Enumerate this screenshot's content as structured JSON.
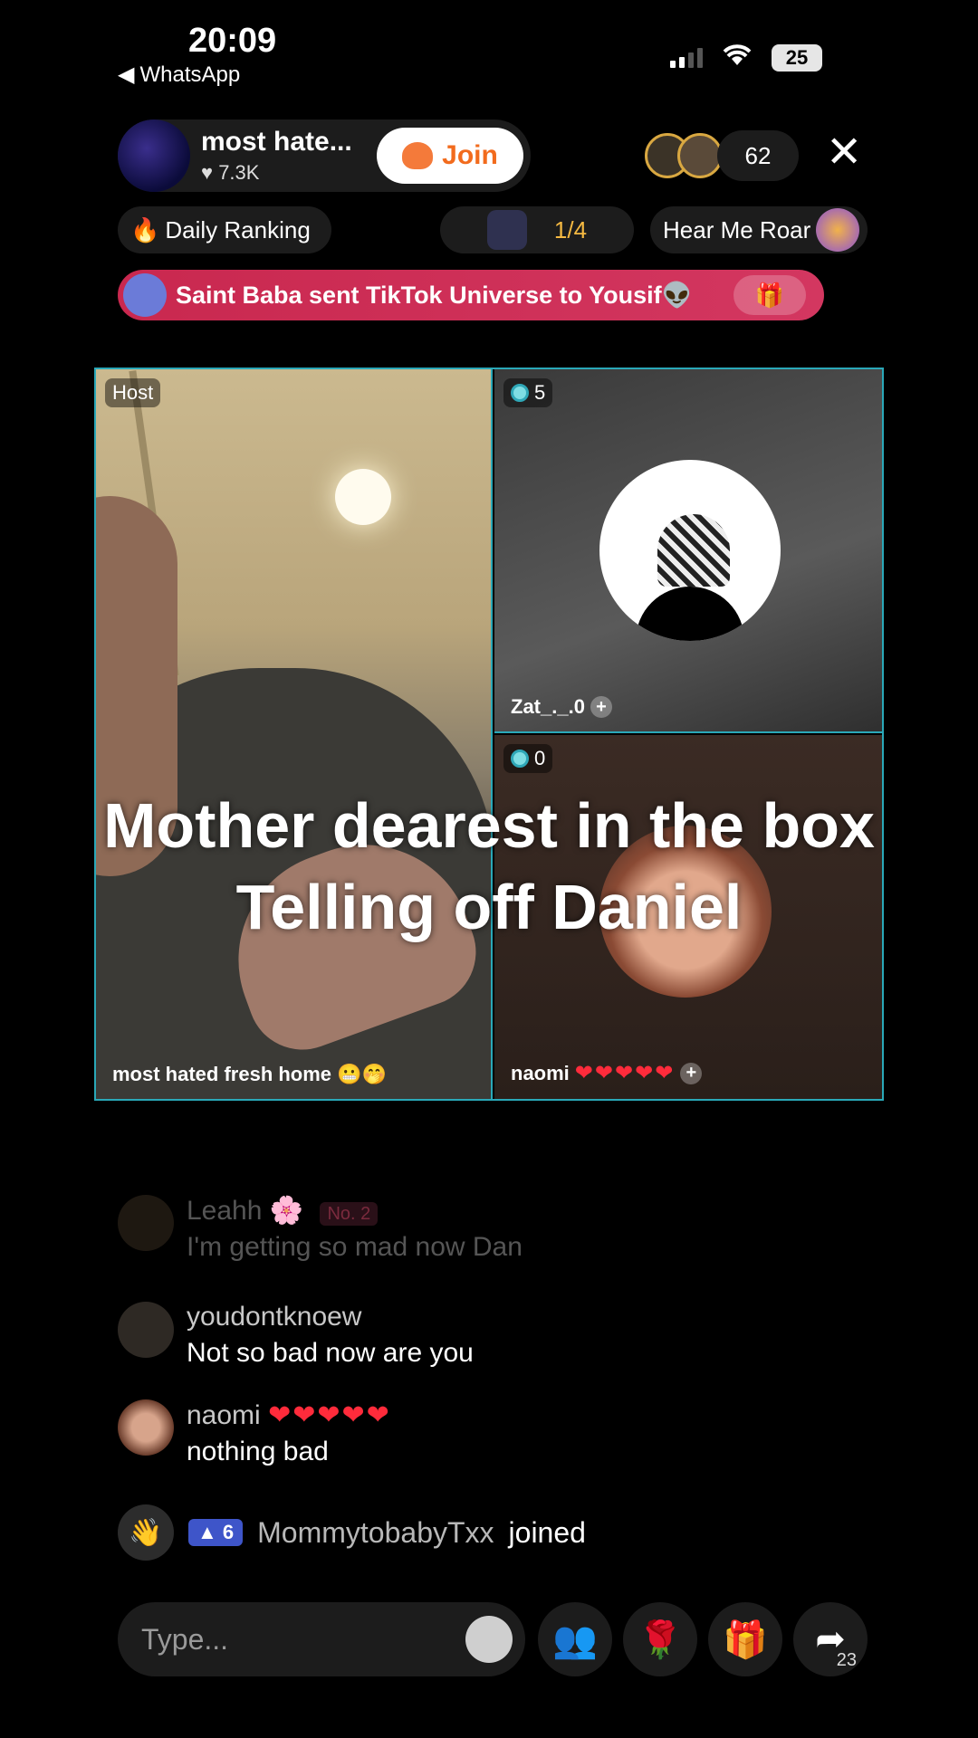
{
  "status_bar": {
    "time": "20:09",
    "back_app": "WhatsApp",
    "battery": "25"
  },
  "header": {
    "host_name": "most hate...",
    "host_likes": "7.3K",
    "join_label": "Join",
    "viewer_count": "62",
    "close_icon": "close-icon"
  },
  "chips": {
    "daily_ranking": "Daily Ranking",
    "rank_progress": "1/4",
    "hear_me": "Hear Me Roar"
  },
  "gift_banner": {
    "text": "Saint Baba sent TikTok Universe to Yousif"
  },
  "tiles": {
    "host_badge": "Host",
    "host_caption": "most hated fresh home",
    "zat_gems": "5",
    "zat_name": "Zat_._.0",
    "naomi_gems": "0",
    "naomi_name": "naomi"
  },
  "caption": {
    "line1": "Mother dearest in the box",
    "line2": "Telling off Daniel"
  },
  "chat": [
    {
      "user": "Leahh",
      "tag": "No. 2",
      "message": "I'm getting so mad now Dan"
    },
    {
      "user": "youdontknoew",
      "message": "Not so bad now are you"
    },
    {
      "user": "naomi",
      "message": "nothing bad"
    }
  ],
  "join_event": {
    "level": "6",
    "user": "MommytobabyTxx",
    "action": "joined"
  },
  "bottom_bar": {
    "input_placeholder": "Type...",
    "share_count": "23"
  },
  "colors": {
    "accent_teal": "#2aa8b8",
    "gift_banner": "#c9284f",
    "join_orange": "#f26b1d"
  }
}
